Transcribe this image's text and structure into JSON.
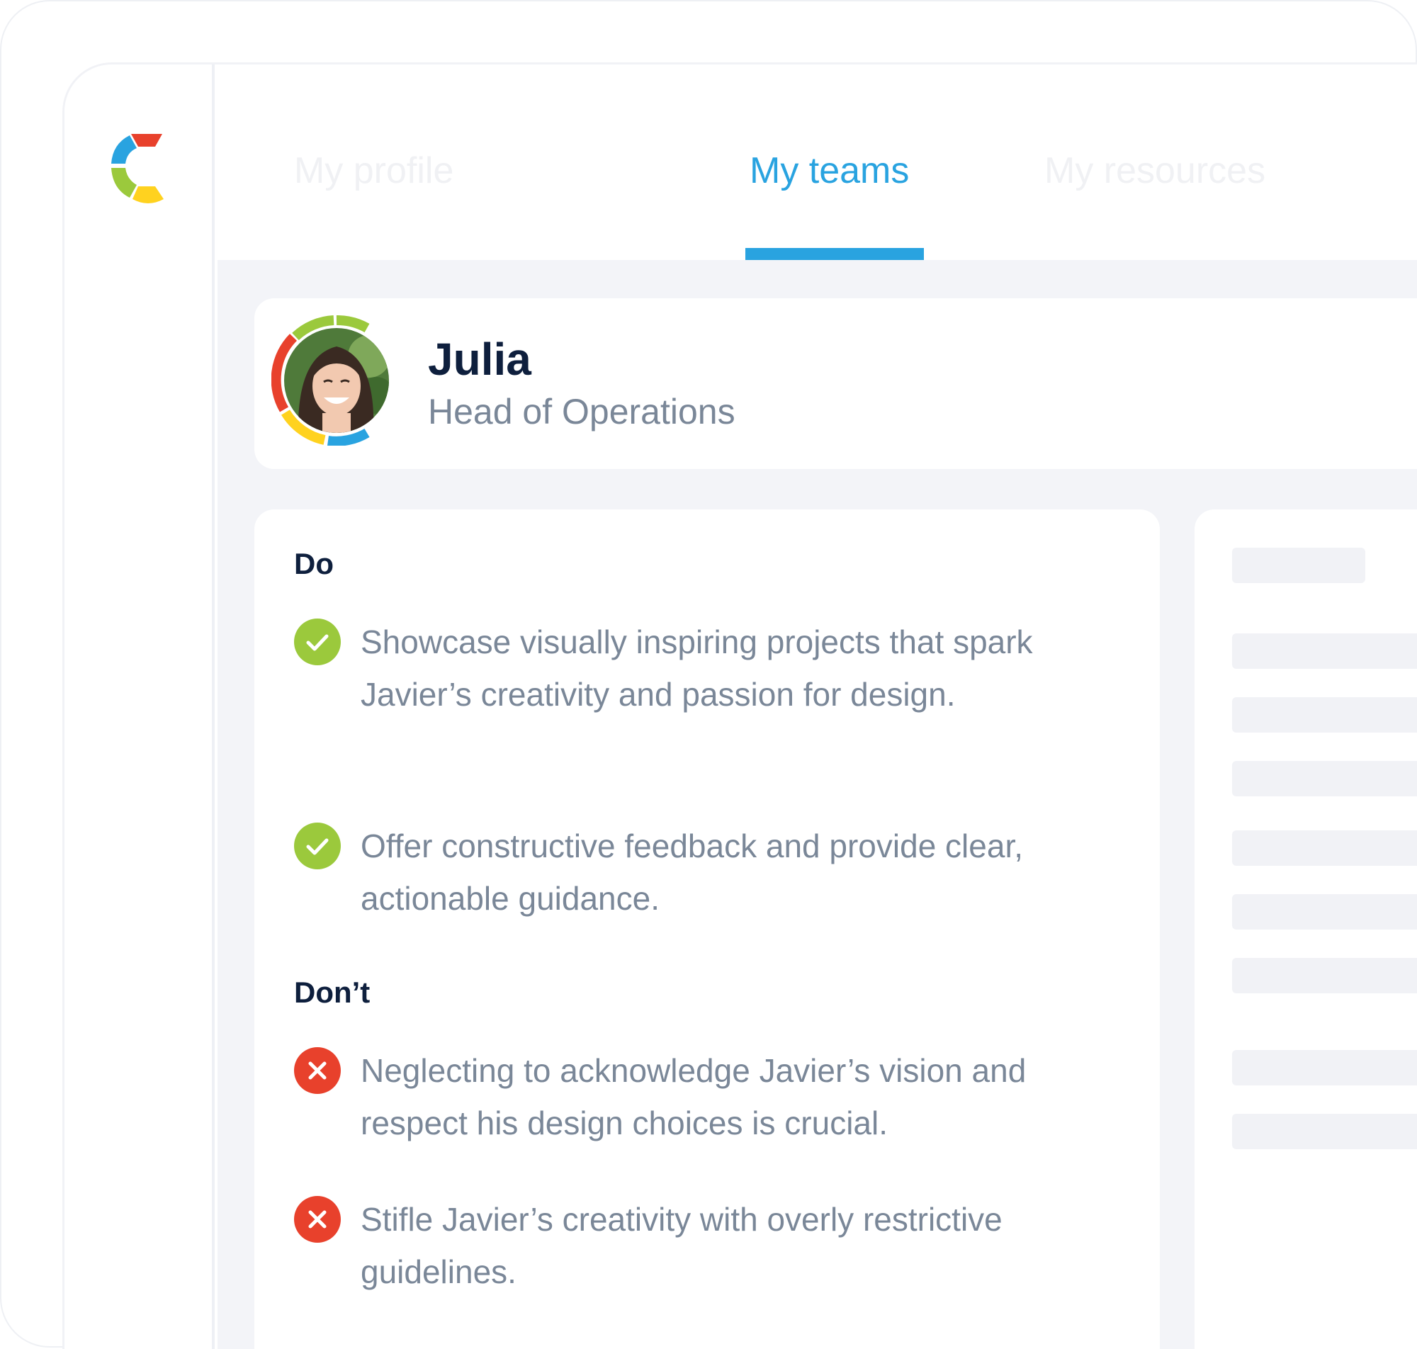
{
  "tabs": [
    {
      "label": "My profile",
      "active": false
    },
    {
      "label": "My teams",
      "active": true
    },
    {
      "label": "My resources",
      "active": false
    }
  ],
  "profile": {
    "name": "Julia",
    "title": "Head of Operations"
  },
  "guide": {
    "do_heading": "Do",
    "do_items": [
      "Showcase visually inspiring projects that spark Javier’s creativity and passion for design.",
      "Offer constructive feedback and provide clear, actionable guidance."
    ],
    "dont_heading": "Don’t",
    "dont_items": [
      "Neglecting to acknowledge Javier’s vision and respect his design choices is crucial.",
      "Stifle Javier’s creativity with overly restrictive guidelines."
    ]
  },
  "icons": {
    "logo": "brand-c-logo",
    "do": "check-circle-icon",
    "dont": "x-circle-icon"
  },
  "colors": {
    "accent": "#29a3e0",
    "do_green": "#9bc93c",
    "dont_red": "#e8412c",
    "heading": "#0e1f3d",
    "body_text": "#7a8798",
    "logo_blue": "#29a3e0",
    "logo_red": "#e8412c",
    "logo_yellow": "#ffd21f",
    "logo_green": "#9bc93c"
  }
}
